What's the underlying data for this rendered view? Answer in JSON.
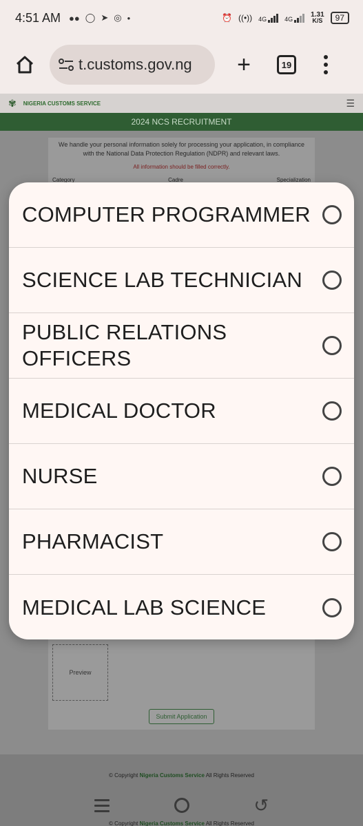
{
  "status_bar": {
    "time": "4:51 AM",
    "net_speed": "1.31",
    "net_unit": "K/S",
    "battery": "97",
    "signal_label_1": "4G",
    "signal_label_2": "4G"
  },
  "browser": {
    "url": "t.customs.gov.ng",
    "tab_count": "19"
  },
  "site": {
    "name": "NIGERIA CUSTOMS SERVICE",
    "banner": "2024 NCS RECRUITMENT",
    "privacy": "We handle your personal information solely for processing your application, in compliance with the National Data Protection Regulation (NDPR) and relevant laws.",
    "warning": "All information should be filled correctly.",
    "field_category": "Category",
    "field_cadre": "Cadre",
    "field_specialization": "Specialization",
    "preview": "Preview",
    "submit": "Submit Application",
    "copyright_prefix": "© Copyright",
    "copyright_org": "Nigeria Customs Service",
    "copyright_suffix": "All Rights Reserved"
  },
  "dialog": {
    "options": [
      {
        "label": "COMPUTER PROGRAMMER"
      },
      {
        "label": "SCIENCE LAB TECHNICIAN"
      },
      {
        "label": "PUBLIC RELATIONS OFFICERS"
      },
      {
        "label": "MEDICAL DOCTOR"
      },
      {
        "label": "NURSE"
      },
      {
        "label": "PHARMACIST"
      },
      {
        "label": "MEDICAL LAB SCIENCE"
      }
    ]
  }
}
